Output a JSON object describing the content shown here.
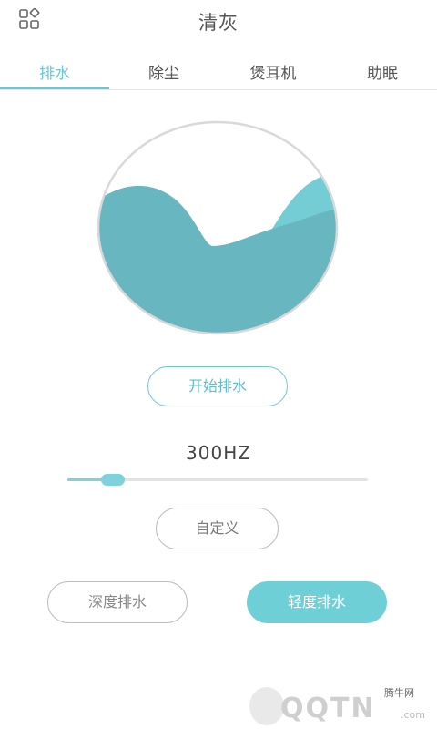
{
  "header": {
    "title": "清灰",
    "menu_icon": "grid-menu-icon"
  },
  "tabs": [
    {
      "label": "排水",
      "active": true
    },
    {
      "label": "除尘",
      "active": false
    },
    {
      "label": "煲耳机",
      "active": false
    },
    {
      "label": "助眠",
      "active": false
    }
  ],
  "wave": {
    "icon": "water-wave-icon",
    "colors": {
      "back": "#74cdd5",
      "front": "#68b6c0",
      "ring": "#d9d9d9"
    }
  },
  "controls": {
    "start_label": "开始排水",
    "frequency": "300HZ",
    "slider_value": 0.15,
    "custom_label": "自定义",
    "deep_label": "深度排水",
    "light_label": "轻度排水"
  },
  "colors": {
    "accent": "#6cc7d1",
    "primary_fill": "#6fcfd6"
  },
  "watermark": {
    "small": "腾牛网",
    "logo": "QQTN",
    "suffix": ".com"
  }
}
